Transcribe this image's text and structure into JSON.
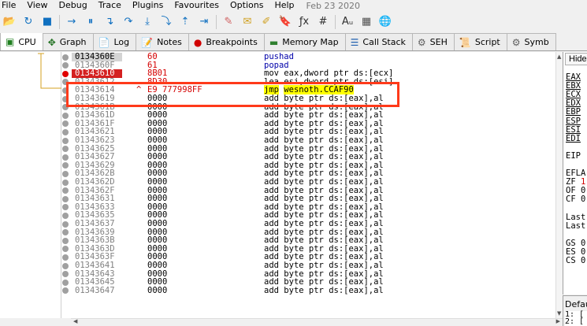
{
  "menu": {
    "items": [
      "File",
      "View",
      "Debug",
      "Trace",
      "Plugins",
      "Favourites",
      "Options",
      "Help"
    ],
    "date": "Feb 23 2020"
  },
  "toolbar": {
    "buttons": [
      {
        "name": "open-icon",
        "glyph": "📂"
      },
      {
        "name": "restart-icon",
        "glyph": "↻"
      },
      {
        "name": "stop-icon",
        "glyph": "■"
      },
      {
        "name": "run-icon",
        "glyph": "→"
      },
      {
        "name": "pause-icon",
        "glyph": "⏸"
      },
      {
        "name": "step-into-icon",
        "glyph": "↴"
      },
      {
        "name": "step-over-icon",
        "glyph": "↷"
      },
      {
        "name": "trace-into-icon",
        "glyph": "⤓"
      },
      {
        "name": "trace-over-icon",
        "glyph": "⤵"
      },
      {
        "name": "execute-till-return-icon",
        "glyph": "⇡"
      },
      {
        "name": "run-to-user-code-icon",
        "glyph": "⇥"
      },
      {
        "name": "patches-icon",
        "glyph": "✎"
      },
      {
        "name": "comments-icon",
        "glyph": "✉"
      },
      {
        "name": "labels-icon",
        "glyph": "✐"
      },
      {
        "name": "bookmarks-icon",
        "glyph": "🔖"
      },
      {
        "name": "functions-icon",
        "glyph": "ƒx"
      },
      {
        "name": "hash-icon",
        "glyph": "#"
      },
      {
        "name": "font-icon",
        "glyph": "Aᵤ"
      },
      {
        "name": "calculator-icon",
        "glyph": "▦"
      },
      {
        "name": "globe-icon",
        "glyph": "🌐"
      }
    ]
  },
  "tabs": [
    {
      "label": "CPU",
      "icon": "cpu-icon",
      "glyph": "▣",
      "active": true
    },
    {
      "label": "Graph",
      "icon": "graph-icon",
      "glyph": "✥",
      "active": false
    },
    {
      "label": "Log",
      "icon": "log-icon",
      "glyph": "📄",
      "active": false
    },
    {
      "label": "Notes",
      "icon": "notes-icon",
      "glyph": "📝",
      "active": false
    },
    {
      "label": "Breakpoints",
      "icon": "breakpoint-icon",
      "glyph": "●",
      "active": false
    },
    {
      "label": "Memory Map",
      "icon": "memory-map-icon",
      "glyph": "▬",
      "active": false
    },
    {
      "label": "Call Stack",
      "icon": "call-stack-icon",
      "glyph": "☰",
      "active": false
    },
    {
      "label": "SEH",
      "icon": "seh-icon",
      "glyph": "⚙",
      "active": false
    },
    {
      "label": "Script",
      "icon": "script-icon",
      "glyph": "📜",
      "active": false
    },
    {
      "label": "Symb",
      "icon": "symbols-icon",
      "glyph": "⚙",
      "active": false
    }
  ],
  "disasm": {
    "rows": [
      {
        "addr": "0134360E",
        "bytes": "60",
        "bytes_red": true,
        "mnemonic": "pushad",
        "operands": "",
        "style": "top",
        "dot": "grey"
      },
      {
        "addr": "0134360F",
        "bytes": "61",
        "bytes_red": true,
        "mnemonic": "popad",
        "operands": "",
        "style": "",
        "dot": "grey"
      },
      {
        "addr": "01343610",
        "bytes": "8B01",
        "bytes_red": true,
        "mnemonic": "mov",
        "operands": "eax,dword ptr ds:[ecx]",
        "style": "hl",
        "dot": "red"
      },
      {
        "addr": "01343612",
        "bytes": "8D30",
        "bytes_red": true,
        "mnemonic": "lea",
        "operands": "esi,dword ptr ds:[esi]",
        "style": "",
        "dot": "grey"
      },
      {
        "addr": "01343614",
        "bytes": "E9 777998FF",
        "bytes_red": true,
        "mark": "^",
        "mnemonic": "jmp",
        "operands": "wesnoth.CCAF90",
        "style": "jmp",
        "dot": "grey"
      },
      {
        "addr": "01343619",
        "bytes": "0000",
        "bytes_red": false,
        "mnemonic": "add",
        "operands": "byte ptr ds:[eax],al",
        "style": "",
        "dot": "grey"
      },
      {
        "addr": "0134361B",
        "bytes": "0000",
        "bytes_red": false,
        "mnemonic": "add",
        "operands": "byte ptr ds:[eax],al",
        "style": "",
        "dot": "grey"
      },
      {
        "addr": "0134361D",
        "bytes": "0000",
        "bytes_red": false,
        "mnemonic": "add",
        "operands": "byte ptr ds:[eax],al",
        "style": "",
        "dot": "grey"
      },
      {
        "addr": "0134361F",
        "bytes": "0000",
        "bytes_red": false,
        "mnemonic": "add",
        "operands": "byte ptr ds:[eax],al",
        "style": "",
        "dot": "grey"
      },
      {
        "addr": "01343621",
        "bytes": "0000",
        "bytes_red": false,
        "mnemonic": "add",
        "operands": "byte ptr ds:[eax],al",
        "style": "",
        "dot": "grey"
      },
      {
        "addr": "01343623",
        "bytes": "0000",
        "bytes_red": false,
        "mnemonic": "add",
        "operands": "byte ptr ds:[eax],al",
        "style": "",
        "dot": "grey"
      },
      {
        "addr": "01343625",
        "bytes": "0000",
        "bytes_red": false,
        "mnemonic": "add",
        "operands": "byte ptr ds:[eax],al",
        "style": "",
        "dot": "grey"
      },
      {
        "addr": "01343627",
        "bytes": "0000",
        "bytes_red": false,
        "mnemonic": "add",
        "operands": "byte ptr ds:[eax],al",
        "style": "",
        "dot": "grey"
      },
      {
        "addr": "01343629",
        "bytes": "0000",
        "bytes_red": false,
        "mnemonic": "add",
        "operands": "byte ptr ds:[eax],al",
        "style": "",
        "dot": "grey"
      },
      {
        "addr": "0134362B",
        "bytes": "0000",
        "bytes_red": false,
        "mnemonic": "add",
        "operands": "byte ptr ds:[eax],al",
        "style": "",
        "dot": "grey"
      },
      {
        "addr": "0134362D",
        "bytes": "0000",
        "bytes_red": false,
        "mnemonic": "add",
        "operands": "byte ptr ds:[eax],al",
        "style": "",
        "dot": "grey"
      },
      {
        "addr": "0134362F",
        "bytes": "0000",
        "bytes_red": false,
        "mnemonic": "add",
        "operands": "byte ptr ds:[eax],al",
        "style": "",
        "dot": "grey"
      },
      {
        "addr": "01343631",
        "bytes": "0000",
        "bytes_red": false,
        "mnemonic": "add",
        "operands": "byte ptr ds:[eax],al",
        "style": "",
        "dot": "grey"
      },
      {
        "addr": "01343633",
        "bytes": "0000",
        "bytes_red": false,
        "mnemonic": "add",
        "operands": "byte ptr ds:[eax],al",
        "style": "",
        "dot": "grey"
      },
      {
        "addr": "01343635",
        "bytes": "0000",
        "bytes_red": false,
        "mnemonic": "add",
        "operands": "byte ptr ds:[eax],al",
        "style": "",
        "dot": "grey"
      },
      {
        "addr": "01343637",
        "bytes": "0000",
        "bytes_red": false,
        "mnemonic": "add",
        "operands": "byte ptr ds:[eax],al",
        "style": "",
        "dot": "grey"
      },
      {
        "addr": "01343639",
        "bytes": "0000",
        "bytes_red": false,
        "mnemonic": "add",
        "operands": "byte ptr ds:[eax],al",
        "style": "",
        "dot": "grey"
      },
      {
        "addr": "0134363B",
        "bytes": "0000",
        "bytes_red": false,
        "mnemonic": "add",
        "operands": "byte ptr ds:[eax],al",
        "style": "",
        "dot": "grey"
      },
      {
        "addr": "0134363D",
        "bytes": "0000",
        "bytes_red": false,
        "mnemonic": "add",
        "operands": "byte ptr ds:[eax],al",
        "style": "",
        "dot": "grey"
      },
      {
        "addr": "0134363F",
        "bytes": "0000",
        "bytes_red": false,
        "mnemonic": "add",
        "operands": "byte ptr ds:[eax],al",
        "style": "",
        "dot": "grey"
      },
      {
        "addr": "01343641",
        "bytes": "0000",
        "bytes_red": false,
        "mnemonic": "add",
        "operands": "byte ptr ds:[eax],al",
        "style": "",
        "dot": "grey"
      },
      {
        "addr": "01343643",
        "bytes": "0000",
        "bytes_red": false,
        "mnemonic": "add",
        "operands": "byte ptr ds:[eax],al",
        "style": "",
        "dot": "grey"
      },
      {
        "addr": "01343645",
        "bytes": "0000",
        "bytes_red": false,
        "mnemonic": "add",
        "operands": "byte ptr ds:[eax],al",
        "style": "",
        "dot": "grey"
      },
      {
        "addr": "01343647",
        "bytes": "0000",
        "bytes_red": false,
        "mnemonic": "add",
        "operands": "byte ptr ds:[eax],al",
        "style": "",
        "dot": "grey"
      }
    ]
  },
  "registers": {
    "hide_label": "Hide",
    "items": [
      {
        "label": "EAX",
        "ul": true
      },
      {
        "label": "EBX",
        "ul": true
      },
      {
        "label": "ECX",
        "ul": true
      },
      {
        "label": "EDX",
        "ul": true
      },
      {
        "label": "EBP",
        "ul": true
      },
      {
        "label": "ESP",
        "ul": true
      },
      {
        "label": "ESI",
        "ul": true
      },
      {
        "label": "EDI",
        "ul": true
      },
      {
        "label": "",
        "ul": false
      },
      {
        "label": "EIP",
        "ul": false
      },
      {
        "label": "",
        "ul": false
      },
      {
        "label": "EFLA",
        "ul": false
      },
      {
        "label": "ZF 1",
        "ul": false,
        "red": true
      },
      {
        "label": "OF 0",
        "ul": false
      },
      {
        "label": "CF 0",
        "ul": false
      },
      {
        "label": "",
        "ul": false
      },
      {
        "label": "Last",
        "ul": false
      },
      {
        "label": "Last",
        "ul": false
      },
      {
        "label": "",
        "ul": false
      },
      {
        "label": "GS 0",
        "ul": false
      },
      {
        "label": "ES 0",
        "ul": false
      },
      {
        "label": "CS 0",
        "ul": false
      }
    ]
  },
  "default_panel": {
    "label": "Defaul",
    "lines": [
      "1: [",
      "2: ["
    ]
  },
  "colors": {
    "highlight_red": "#d42020",
    "annotation_box": "#ff3a1a",
    "jmp_yellow": "#ffff00"
  }
}
